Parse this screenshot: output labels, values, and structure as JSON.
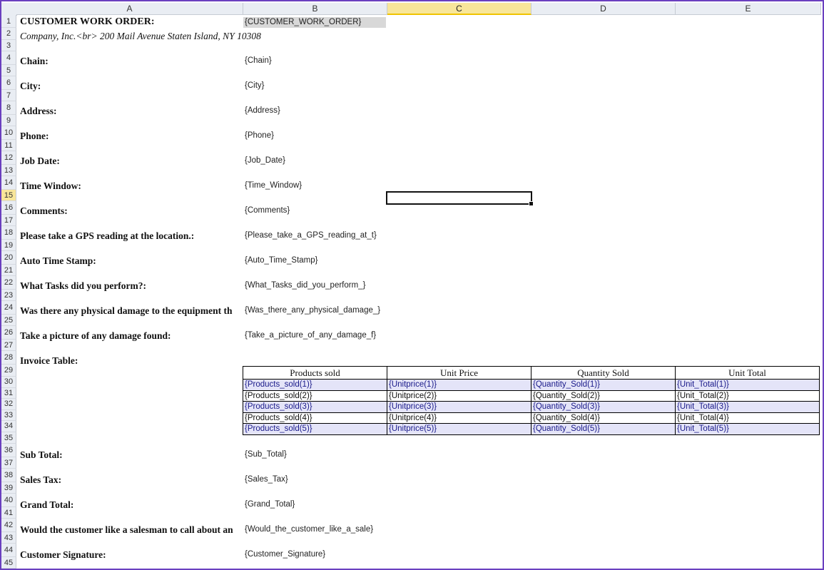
{
  "columns": [
    "A",
    "B",
    "C",
    "D",
    "E"
  ],
  "selected_column": "C",
  "rows": [
    "1",
    "2",
    "3",
    "4",
    "5",
    "6",
    "7",
    "8",
    "9",
    "10",
    "11",
    "12",
    "13",
    "14",
    "15",
    "16",
    "17",
    "18",
    "19",
    "20",
    "21",
    "22",
    "23",
    "24",
    "25",
    "26",
    "27",
    "28",
    "29",
    "30",
    "31",
    "32",
    "33",
    "34",
    "35",
    "36",
    "37",
    "38",
    "39",
    "40",
    "41",
    "42",
    "43",
    "44",
    "45"
  ],
  "selected_row": "15",
  "title": "CUSTOMER WORK ORDER:",
  "title_value": "{CUSTOMER_WORK_ORDER}",
  "company": "Company, Inc.<br> 200 Mail Avenue  Staten Island, NY 10308",
  "fields": [
    {
      "label": "Chain:",
      "value": "{Chain}"
    },
    {
      "label": "City:",
      "value": "{City}"
    },
    {
      "label": "Address:",
      "value": "{Address}"
    },
    {
      "label": "Phone:",
      "value": "{Phone}"
    },
    {
      "label": "Job Date:",
      "value": "{Job_Date}"
    },
    {
      "label": "Time Window:",
      "value": "{Time_Window}"
    },
    {
      "label": "Comments:",
      "value": "{Comments}"
    },
    {
      "label": "Please take a GPS reading at the location.:",
      "value": "{Please_take_a_GPS_reading_at_t}"
    },
    {
      "label": "Auto Time Stamp:",
      "value": "{Auto_Time_Stamp}"
    },
    {
      "label": "What Tasks did you perform?:",
      "value": "{What_Tasks_did_you_perform_}"
    },
    {
      "label": "Was there any physical damage to the equipment th",
      "value": "{Was_there_any_physical_damage_}"
    },
    {
      "label": "Take a picture of any damage found:",
      "value": "{Take_a_picture_of_any_damage_f}"
    },
    {
      "label": "Invoice Table:",
      "value": ""
    }
  ],
  "invoice": {
    "headers": [
      "Products sold",
      "Unit Price",
      "Quantity Sold",
      "Unit Total"
    ],
    "rows": [
      [
        "{Products_sold(1)}",
        "{Unitprice(1)}",
        "{Quantity_Sold(1)}",
        "{Unit_Total(1)}"
      ],
      [
        "{Products_sold(2)}",
        "{Unitprice(2)}",
        "{Quantity_Sold(2)}",
        "{Unit_Total(2)}"
      ],
      [
        "{Products_sold(3)}",
        "{Unitprice(3)}",
        "{Quantity_Sold(3)}",
        "{Unit_Total(3)}"
      ],
      [
        "{Products_sold(4)}",
        "{Unitprice(4)}",
        "{Quantity_Sold(4)}",
        "{Unit_Total(4)}"
      ],
      [
        "{Products_sold(5)}",
        "{Unitprice(5)}",
        "{Quantity_Sold(5)}",
        "{Unit_Total(5)}"
      ]
    ]
  },
  "totals": [
    {
      "label": "Sub Total:",
      "value": "{Sub_Total}"
    },
    {
      "label": "Sales Tax:",
      "value": "{Sales_Tax}"
    },
    {
      "label": "Grand Total:",
      "value": "{Grand_Total}"
    },
    {
      "label": "Would the customer like a salesman to call about an",
      "value": "{Would_the_customer_like_a_sale}"
    },
    {
      "label": "Customer Signature:",
      "value": "{Customer_Signature}"
    }
  ],
  "colors": {
    "frame": "#6a3fbf",
    "header_bg": "#e9edf3",
    "selected_header": "#f8e69a",
    "band": "#e4e4f8"
  }
}
